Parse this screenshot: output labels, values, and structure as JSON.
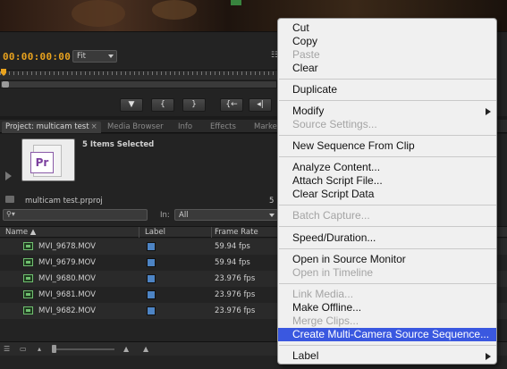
{
  "monitor": {
    "timecode": "00:00:00:00",
    "fit_value": "Fit"
  },
  "transport": [
    "▼",
    "{",
    "}",
    "{←",
    "◂|"
  ],
  "tabs": {
    "project": "Project: multicam test",
    "media_browser": "Media Browser",
    "info": "Info",
    "effects": "Effects",
    "markers": "Marke"
  },
  "project": {
    "selection_text": "5 Items Selected",
    "file_name": "multicam test.prproj",
    "items_count": "5",
    "search_placeholder": "",
    "in_label": "In:",
    "in_value": "All",
    "columns": {
      "name": "Name",
      "label": "Label",
      "frame_rate": "Frame Rate"
    },
    "rows": [
      {
        "name": "MVI_9678.MOV",
        "label_color": "#4d84c4",
        "frame_rate": "59.94 fps"
      },
      {
        "name": "MVI_9679.MOV",
        "label_color": "#4d84c4",
        "frame_rate": "59.94 fps"
      },
      {
        "name": "MVI_9680.MOV",
        "label_color": "#4d84c4",
        "frame_rate": "23.976 fps"
      },
      {
        "name": "MVI_9681.MOV",
        "label_color": "#4d84c4",
        "frame_rate": "23.976 fps"
      },
      {
        "name": "MVI_9682.MOV",
        "label_color": "#4d84c4",
        "frame_rate": "23.976 fps"
      }
    ]
  },
  "context_menu": {
    "items": [
      {
        "label": "Cut",
        "disabled": false
      },
      {
        "label": "Copy",
        "disabled": false
      },
      {
        "label": "Paste",
        "disabled": true
      },
      {
        "label": "Clear",
        "disabled": false
      },
      {
        "label": "Duplicate",
        "disabled": false
      },
      {
        "label": "Modify",
        "disabled": false,
        "submenu": true
      },
      {
        "label": "Source Settings...",
        "disabled": true
      },
      {
        "label": "New Sequence From Clip",
        "disabled": false
      },
      {
        "label": "Analyze Content...",
        "disabled": false
      },
      {
        "label": "Attach Script File...",
        "disabled": false
      },
      {
        "label": "Clear Script Data",
        "disabled": false
      },
      {
        "label": "Batch Capture...",
        "disabled": true
      },
      {
        "label": "Speed/Duration...",
        "disabled": false
      },
      {
        "label": "Open in Source Monitor",
        "disabled": false
      },
      {
        "label": "Open in Timeline",
        "disabled": true
      },
      {
        "label": "Link Media...",
        "disabled": true
      },
      {
        "label": "Make Offline...",
        "disabled": false
      },
      {
        "label": "Merge Clips...",
        "disabled": true
      },
      {
        "label": "Create Multi-Camera Source Sequence...",
        "disabled": false,
        "highlighted": true
      },
      {
        "label": "Label",
        "disabled": false,
        "submenu": true
      }
    ]
  },
  "colors": {
    "timecode": "#e8a21e",
    "menu_highlight": "#3a58e0",
    "label_swatch": "#4d84c4"
  }
}
